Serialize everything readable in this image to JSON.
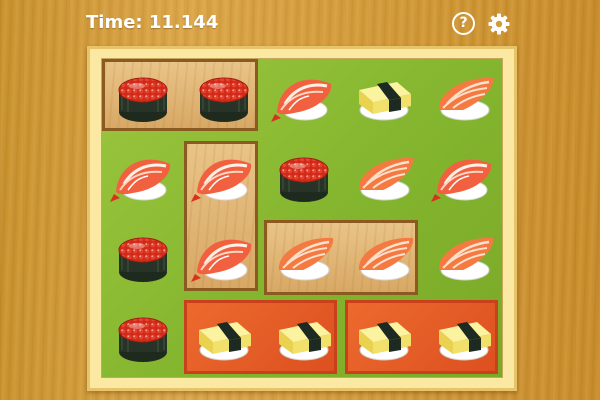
{
  "hud": {
    "time_label": "Time: 11.144",
    "help_icon": "question-circle-icon",
    "settings_icon": "gear-icon"
  },
  "colors": {
    "board_green": "#8dbb34",
    "wood_block": "#e2b978",
    "red_block": "#e35a24",
    "frame": "#fbe8a2",
    "table_wood": "#d39c3a"
  },
  "board": {
    "columns": 5,
    "rows": 4,
    "pieces": [
      [
        "salmon-roe-gunkan",
        "salmon-roe-gunkan",
        "shrimp-nigiri",
        "tamago-nigiri",
        "salmon-nigiri"
      ],
      [
        "shrimp-nigiri",
        "shrimp-nigiri",
        "salmon-roe-gunkan",
        "salmon-nigiri",
        "shrimp-nigiri"
      ],
      [
        "salmon-roe-gunkan",
        "shrimp-nigiri",
        "salmon-nigiri",
        "salmon-nigiri",
        "salmon-nigiri"
      ],
      [
        "salmon-roe-gunkan",
        "tamago-nigiri",
        "tamago-nigiri",
        "tamago-nigiri",
        "tamago-nigiri"
      ]
    ],
    "blocks": [
      {
        "name": "block-roe-pair",
        "style": "wood",
        "orientation": "horizontal",
        "pieces": [
          "salmon-roe-gunkan",
          "salmon-roe-gunkan"
        ]
      },
      {
        "name": "block-shrimp-pair",
        "style": "wood",
        "orientation": "vertical",
        "pieces": [
          "shrimp-nigiri",
          "shrimp-nigiri"
        ]
      },
      {
        "name": "block-salmon-pair",
        "style": "wood",
        "orientation": "horizontal",
        "pieces": [
          "salmon-nigiri",
          "salmon-nigiri"
        ]
      },
      {
        "name": "block-tamago-pair-left",
        "style": "red",
        "orientation": "horizontal",
        "pieces": [
          "tamago-nigiri",
          "tamago-nigiri"
        ]
      },
      {
        "name": "block-tamago-pair-right",
        "style": "red",
        "orientation": "horizontal",
        "pieces": [
          "tamago-nigiri",
          "tamago-nigiri"
        ]
      }
    ]
  }
}
